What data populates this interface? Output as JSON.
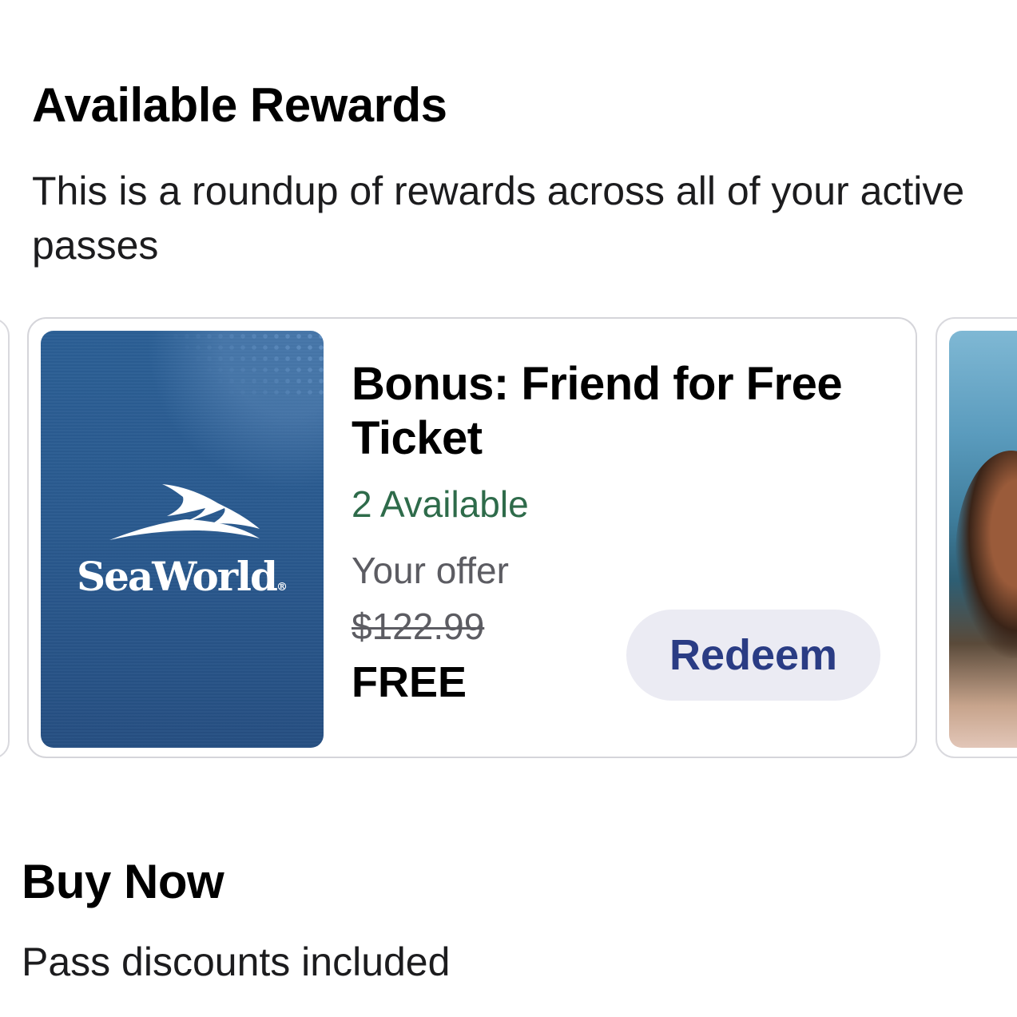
{
  "rewards": {
    "title": "Available Rewards",
    "description": "This is a roundup of rewards across all of your active passes",
    "card": {
      "brand": "SeaWorld",
      "title": "Bonus: Friend for Free Ticket",
      "availability": "2 Available",
      "offer_label": "Your offer",
      "original_price": "$122.99",
      "offer_price": "FREE",
      "button_label": "Redeem"
    }
  },
  "buy_now": {
    "title": "Buy Now",
    "description": "Pass discounts included"
  },
  "colors": {
    "availability": "#2e6b4a",
    "button_bg": "#ebebf3",
    "button_text": "#2a3c84",
    "brand_blue": "#2a5a8f"
  }
}
